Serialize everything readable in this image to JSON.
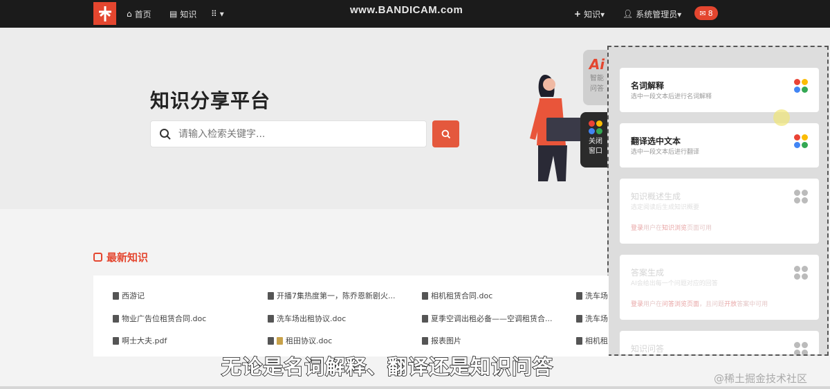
{
  "navbar": {
    "home_label": "首页",
    "knowledge_label": "知识",
    "apps_label": "▾",
    "watermark": "www.BANDICAM.com",
    "add_knowledge_label": "知识▾",
    "user_label": "系统管理员▾",
    "message_count": "8"
  },
  "hero": {
    "title": "知识分享平台",
    "search_placeholder": "请输入检索关键字..."
  },
  "side_tabs": {
    "ai_logo": "Ai",
    "ai_line1": "智能",
    "ai_line2": "问答",
    "close_line1": "关闭",
    "close_line2": "窗口"
  },
  "panel": {
    "cards": [
      {
        "title": "名词解释",
        "desc": "选中一段文本后进行名词解释"
      },
      {
        "title": "翻译选中文本",
        "desc": "选中一段文本后进行翻译"
      },
      {
        "title": "知识概述生成",
        "desc": "选定阅读后生成知识概要",
        "note_a": "登录",
        "note_b": "用户在",
        "note_c": "知识浏览",
        "note_d": "页面可用"
      },
      {
        "title": "答案生成",
        "desc": "AI会给出每一个问题对应的回答",
        "note_a": "登录",
        "note_b": "用户在",
        "note_c": "问答浏览页面",
        "note_d": "，且问题",
        "note_e": "开放",
        "note_f": "答案中可用"
      },
      {
        "title": "知识问答"
      }
    ]
  },
  "latest": {
    "title": "最新知识",
    "items": [
      "西游记",
      "开播7集热度第一，陈乔恩新剧火...",
      "相机租赁合同.doc",
      "洗车场",
      "物业广告位租赁合同.doc",
      "洗车场出租协议.doc",
      "夏季空调出租必备——空调租赁合...",
      "洗车场",
      "啊士大夫.pdf",
      "租田协议.doc",
      "报表图片",
      "相机租"
    ]
  },
  "subtitle": "无论是名词解释、翻译还是知识问答",
  "bottom_watermark": "@稀土掘金技术社区",
  "colors": {
    "accent": "#e4462f",
    "navbar_bg": "#1b1b1b",
    "dot_red": "#ea4335",
    "dot_yellow": "#fbbc05",
    "dot_blue": "#4285f4",
    "dot_green": "#34a853"
  }
}
